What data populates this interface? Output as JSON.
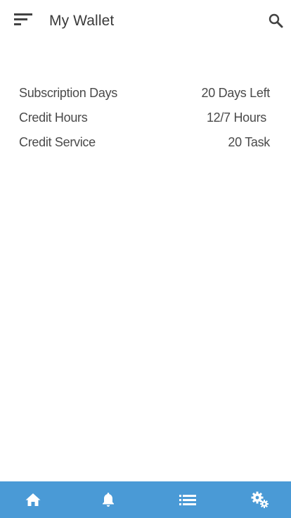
{
  "header": {
    "title": "My Wallet",
    "menu_icon": "sort-menu-icon",
    "search_icon": "search-icon"
  },
  "wallet": {
    "rows": [
      {
        "label": "Subscription Days",
        "value": "20 Days Left"
      },
      {
        "label": "Credit Hours",
        "value": "12/7 Hours"
      },
      {
        "label": "Credit Service",
        "value": "20 Task"
      }
    ]
  },
  "bottom_nav": {
    "background": "#4a9ad6",
    "items": [
      {
        "icon": "home-icon"
      },
      {
        "icon": "bell-icon"
      },
      {
        "icon": "list-icon"
      },
      {
        "icon": "gears-icon"
      }
    ]
  },
  "colors": {
    "text": "#4a4a4a",
    "title": "#3a3a3a",
    "icon": "#424242",
    "nav_icon": "#ffffff"
  }
}
